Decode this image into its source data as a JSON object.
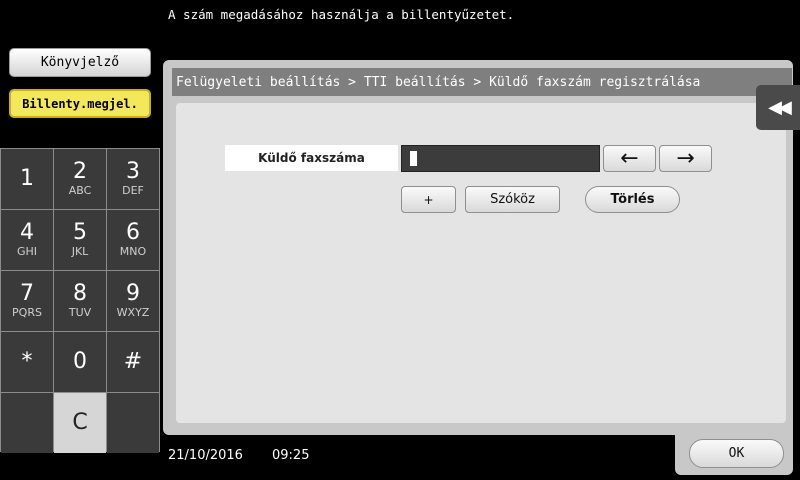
{
  "message": "A szám megadásához használja a billentyűzetet.",
  "sidebar": {
    "counter_label": "Könyvjelző",
    "keypad_label": "Billenty.megjel."
  },
  "keypad": [
    {
      "digit": "1",
      "letters": ""
    },
    {
      "digit": "2",
      "letters": "ABC"
    },
    {
      "digit": "3",
      "letters": "DEF"
    },
    {
      "digit": "4",
      "letters": "GHI"
    },
    {
      "digit": "5",
      "letters": "JKL"
    },
    {
      "digit": "6",
      "letters": "MNO"
    },
    {
      "digit": "7",
      "letters": "PQRS"
    },
    {
      "digit": "8",
      "letters": "TUV"
    },
    {
      "digit": "9",
      "letters": "WXYZ"
    },
    {
      "digit": "*",
      "letters": ""
    },
    {
      "digit": "0",
      "letters": ""
    },
    {
      "digit": "#",
      "letters": ""
    },
    {
      "digit": "",
      "letters": ""
    },
    {
      "digit": "C",
      "letters": ""
    },
    {
      "digit": "",
      "letters": ""
    }
  ],
  "breadcrumb": "Felügyeleti beállítás > TTI beállítás > Küldő faxszám regisztrálása",
  "form": {
    "field_label": "Küldő faxszáma",
    "value": ""
  },
  "buttons": {
    "left_arrow": "←",
    "right_arrow": "→",
    "plus": "+",
    "space": "Szóköz",
    "delete": "Törlés",
    "ok": "OK",
    "collapse": "◀◀"
  },
  "status": {
    "date": "21/10/2016",
    "time": "09:25"
  }
}
